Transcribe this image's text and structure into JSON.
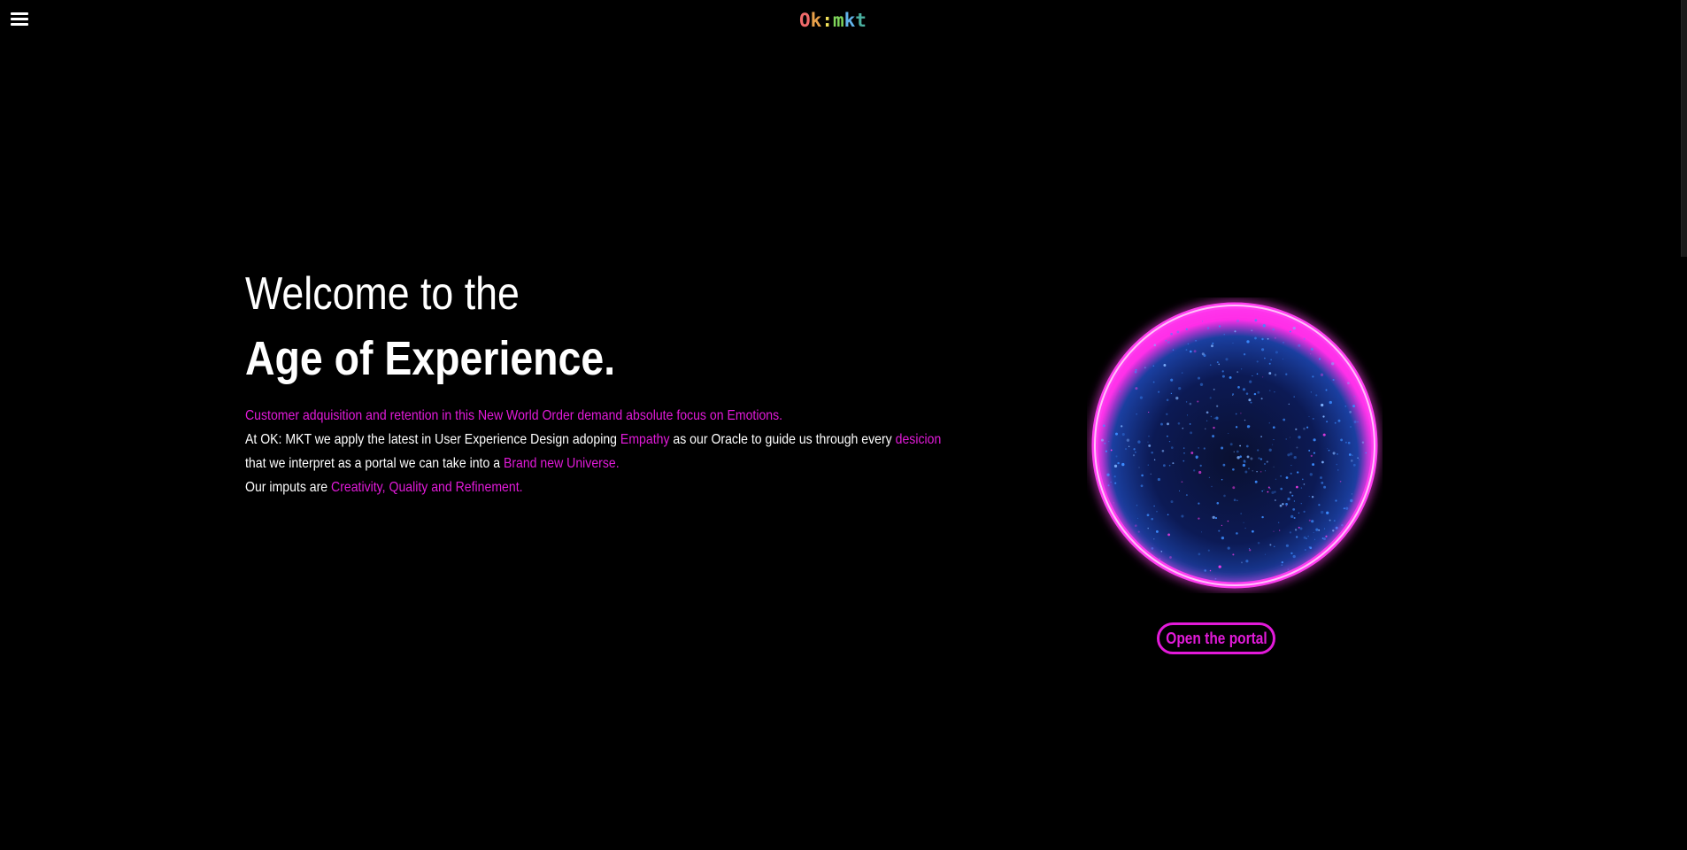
{
  "header": {
    "menu_icon": "hamburger-menu-icon",
    "logo": {
      "chars": [
        "O",
        "k",
        ":",
        "m",
        "k",
        "t"
      ],
      "colors": [
        "#f06a6a",
        "#e8a04a",
        "#f2e25a",
        "#7fd65a",
        "#62b3ea",
        "#4ab0a0"
      ]
    }
  },
  "hero": {
    "title_line1": "Welcome to the",
    "title_line2": "Age of Experience.",
    "paragraph": {
      "line1": "Customer adquisition and retention in this New World Order demand absolute focus on Emotions.",
      "line2_a": "At OK: MKT we apply the latest in User Experience Design adoping ",
      "line2_b": "Empathy",
      "line2_c": " as our Oracle to guide us through every ",
      "line2_d": "desicion",
      "line3_a": "that we interpret as a portal we can take into a ",
      "line3_b": "Brand new Universe.",
      "line4_a": "Our imputs are ",
      "line4_b": "Creativity, Quality and Refinement."
    }
  },
  "portal": {
    "button_label": "Open the portal",
    "accent_color": "#e21ad9",
    "particle_color": "#3b8bff"
  }
}
